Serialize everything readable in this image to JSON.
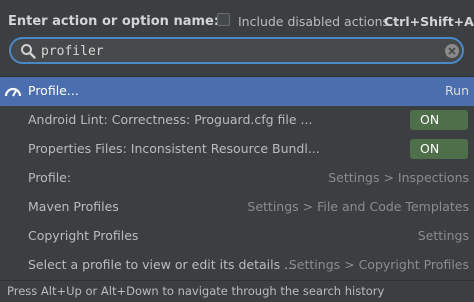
{
  "header": {
    "prompt_label": "Enter action or option name:",
    "include_disabled_label": "Include disabled actions",
    "include_disabled_checked": false,
    "shortcut": "Ctrl+Shift+A"
  },
  "search": {
    "value": "profiler",
    "icon": "search-icon",
    "clear_icon": "clear-icon"
  },
  "results": [
    {
      "name": "Profile...",
      "right": "Run",
      "selected": true,
      "icon": "gauge-icon"
    },
    {
      "name": "Android Lint: Correctness: Proguard.cfg file ...",
      "toggle": "ON"
    },
    {
      "name": "Properties Files: Inconsistent Resource Bundl...",
      "toggle": "ON"
    },
    {
      "name": "Profile:",
      "right": "Settings > Inspections"
    },
    {
      "name": "Maven Profiles",
      "right": "Settings > File and Code Templates"
    },
    {
      "name": "Copyright Profiles",
      "right": "Settings"
    },
    {
      "name": "Select a profile to view or edit its details ...",
      "right": "Settings > Copyright Profiles"
    }
  ],
  "colors": {
    "background": "#3c3f41",
    "selection": "#4b6eaf",
    "toggle_on": "#4f6e4a",
    "focus_border": "#4a88c7"
  },
  "footer": {
    "hint": "Press Alt+Up or Alt+Down to navigate through the search history"
  }
}
